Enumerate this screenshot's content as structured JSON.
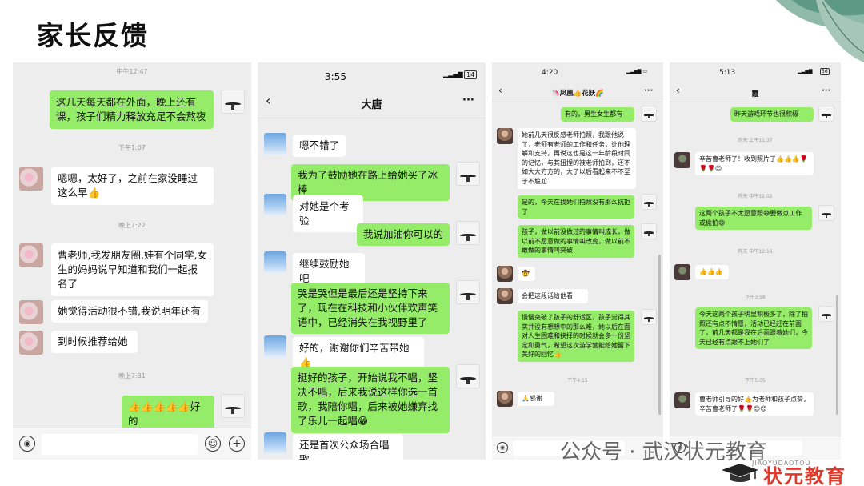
{
  "title": "家长反馈",
  "phone1": {
    "times": [
      "中午12:47",
      "下午1:07",
      "晚上7:22",
      "晚上7:31"
    ],
    "messages": [
      "这几天每天都在外面，晚上还有课，孩子们精力释放充足不会熬夜",
      "嗯嗯，太好了，之前在家没睡过这么早👍",
      "曹老师,我发朋友圈,娃有个同学,女生的妈妈说早知道和我们一起报名了",
      "她觉得活动很不错,我说明年还有",
      "到时候推荐给她",
      "👍👍👍👍👍好的"
    ]
  },
  "phone2": {
    "status_time": "3:55",
    "battery": "14",
    "chat_title": "大唐",
    "messages": [
      "嗯不错了",
      "我为了鼓励她在路上给她买了冰棒",
      "对她是个考验",
      "我说加油你可以的",
      "继续鼓励她吧",
      "哭是哭但是最后还是坚持下来了，现在在科技和小伙伴欢声笑语中，已经消失在我视野里了",
      "好的，谢谢你们辛苦带她👍",
      "挺好的孩子，开始说我不唱，坚决不唱，后来我说这样你选一首歌，我陪你唱，后来被她嫌弃找了乐儿一起唱😁",
      "还是首次公众场合唱歌"
    ]
  },
  "phone3": {
    "status_time": "4:20",
    "chat_title": "🦄凤凰👍花妖🌈",
    "times": [
      "下午4:15"
    ],
    "messages": [
      "有的，男生女生都有",
      "她前几天很反感老师拍照，我跟他说了，老师有老师的工作和任务，让他理解和支持，再说这也是这一年龄段时间的记忆，与其扭捏的被老师拍到，还不如大大方方的，大了以后看起来不不至于不尴尬",
      "是的，今天在找她们拍照没有那么抗拒了",
      "孩子，做以前没做过的事情叫成长，做以前不愿意做的事情叫改变，做以前不敢做的事情叫突破",
      "🤠",
      "会把这段话给他看",
      "慢慢突破了孩子的舒适区，孩子觉得其实并没有想想中的那么难，她以后在面对人生困难和抉择的时候就会多一份坚定和勇气，希望这次游学营能给她留下美好的回忆👍",
      "🙏感谢"
    ]
  },
  "phone4": {
    "status_time": "5:13",
    "battery": "56",
    "chat_title": "霞",
    "times": [
      "昨天 上午11:37",
      "昨天 中午12:02",
      "昨天 中午12:16",
      "下午3:58",
      "下午5:05"
    ],
    "messages": [
      "昨天游戏环节也很积极",
      "辛苦曹老师了！收到照片了👍👍👍🌹🌹🌹😊",
      "这两个孩子不太愿意照😅要做点工作或偷拍😄",
      "👍👍👍",
      "今天这两个孩子明显积极多了，除了拍照还有点不情愿，活动已经赶在前面了，前几天都是我在后面跟着她们，今天已经有点跟不上她们了",
      "曹老师引导的好👍为老师和孩子点赞，辛苦曹老师了🌹🌹😊😊"
    ]
  },
  "watermark": {
    "text": "公众号 · 武汉状元教育",
    "sub": "JIAOYUDAOTOU",
    "brand": "状元教育"
  }
}
